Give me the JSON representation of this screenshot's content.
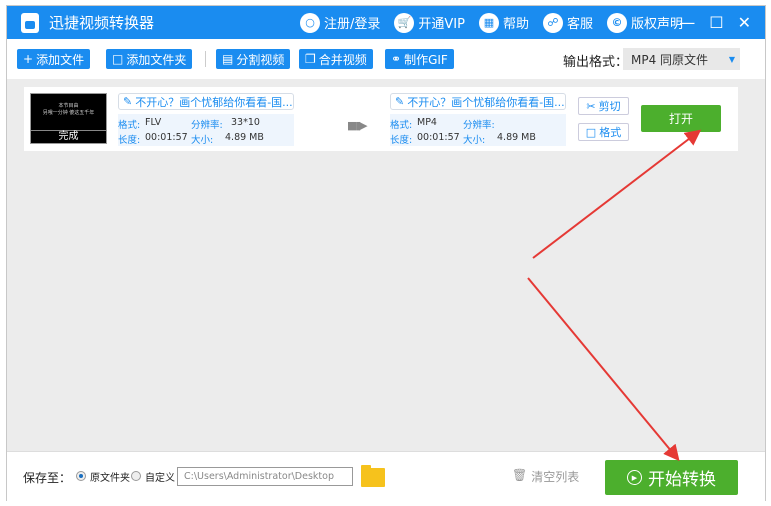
{
  "app": {
    "title": "迅捷视频转换器"
  },
  "title_links": [
    {
      "label": "注册/登录",
      "icon": "user-icon"
    },
    {
      "label": "开通VIP",
      "icon": "cart-icon"
    },
    {
      "label": "帮助",
      "icon": "grid-icon"
    },
    {
      "label": "客服",
      "icon": "headset-icon"
    },
    {
      "label": "版权声明",
      "icon": "copyright-icon"
    }
  ],
  "toolbar": {
    "add_file": "添加文件",
    "add_folder": "添加文件夹",
    "split": "分割视频",
    "merge": "合并视频",
    "gif": "制作GIF",
    "format_label": "输出格式：",
    "format_value": "MP4  同原文件"
  },
  "file": {
    "thumb_line1": "本节目由",
    "thumb_line2": "另哦一分钟 傻这五千年",
    "status": "完成",
    "src": {
      "name": "不开心？画个忧郁给你看看-国...",
      "format_k": "格式:",
      "format": "FLV",
      "res_k": "分辨率:",
      "res": "33*10",
      "dur_k": "长度:",
      "dur": "00:01:57",
      "size_k": "大小:",
      "size": "4.89 MB"
    },
    "dst": {
      "name": "不开心？画个忧郁给你看看-国...",
      "format_k": "格式:",
      "format": "MP4",
      "res_k": "分辨率:",
      "res": "",
      "dur_k": "长度:",
      "dur": "00:01:57",
      "size_k": "大小:",
      "size": "4.89 MB"
    },
    "cut": "剪切",
    "fmt": "格式",
    "open": "打开"
  },
  "bottom": {
    "save_label": "保存至：",
    "opt_original": "原文件夹",
    "opt_custom": "自定义",
    "path": "C:\\Users\\Administrator\\Desktop",
    "clear": "清空列表",
    "start": "开始转换"
  },
  "colors": {
    "brand": "#1a8cf0",
    "green": "#4caf2d",
    "annotation": "#e53935"
  }
}
